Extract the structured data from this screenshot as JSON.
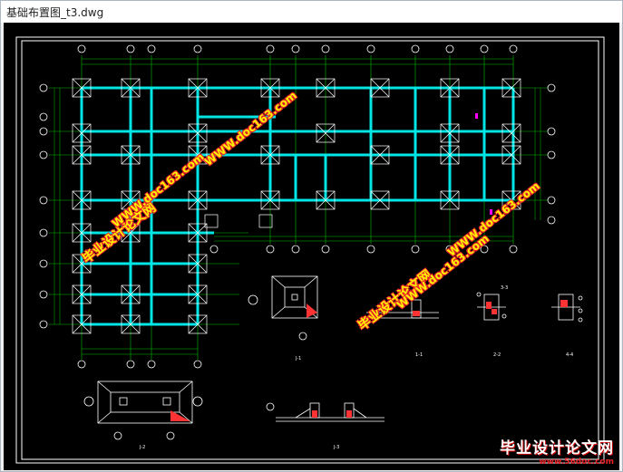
{
  "window": {
    "title": "基础布置图_t3.dwg"
  },
  "colors": {
    "background": "#000000",
    "grid": "#00ff00",
    "beam": "#00ffff",
    "footing": "#ffffff",
    "accent": "#ff00ff",
    "watermark": "#fff200"
  },
  "watermarks": {
    "site_name": "毕业设计论文网",
    "site_url": "WWW.doc163.com"
  },
  "logo": {
    "text": "毕业设计论文网",
    "url": "www.56doc.com"
  },
  "drawing_labels": {
    "section_1_1": "1-1",
    "section_2_2": "2-2",
    "section_3_3": "3-3",
    "section_4_4": "4-4",
    "section_j1": "J-1",
    "section_j2": "J-2",
    "section_j3": "J-3"
  }
}
